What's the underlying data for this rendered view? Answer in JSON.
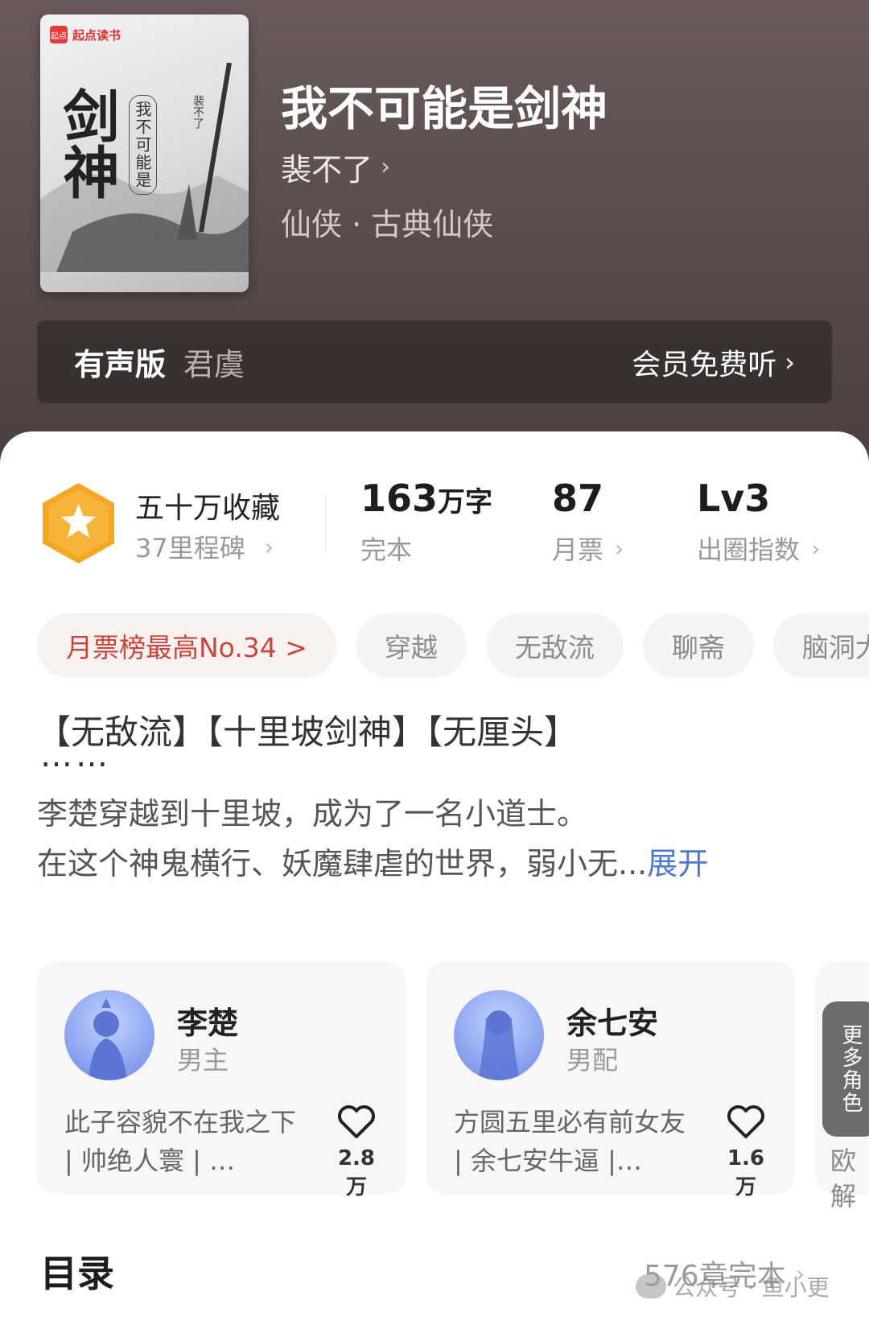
{
  "book": {
    "cover": {
      "publisher": "起点读书",
      "publisher_badge": "起点",
      "big_title": "剑神",
      "sub_title": "我不可能是",
      "author": "裴不了"
    },
    "title": "我不可能是剑神",
    "author": "裴不了",
    "genre": "仙侠 · 古典仙侠"
  },
  "audio": {
    "label": "有声版",
    "narrator": "君虞",
    "action": "会员免费听"
  },
  "stats": {
    "collect_main": "五十万收藏",
    "collect_sub": "37里程碑",
    "words_value": "163",
    "words_unit": "万字",
    "words_label": "完本",
    "tickets_value": "87",
    "tickets_label": "月票",
    "level_value": "Lv3",
    "level_label": "出圈指数"
  },
  "tags": {
    "rank": "月票榜最高No.34 >",
    "items": [
      "穿越",
      "无敌流",
      "聊斋",
      "脑洞大"
    ]
  },
  "synopsis": {
    "keywords": "【无敌流】【十里坡剑神】【无厘头】",
    "dots": "……",
    "line1": "李楚穿越到十里坡，成为了一名小道士。",
    "line2": "在这个神鬼横行、妖魔肆虐的世界，弱小无...",
    "expand": "展开"
  },
  "characters": [
    {
      "name": "李楚",
      "role": "男主",
      "desc": "此子容貌不在我之下 | 帅绝人寰 | …",
      "likes": "2.8万"
    },
    {
      "name": "余七安",
      "role": "男配",
      "desc": "方圆五里必有前女友 | 余七安牛逼 |…",
      "likes": "1.6万"
    }
  ],
  "more_chars": {
    "button": "更多角色",
    "text": "欧解"
  },
  "toc": {
    "title": "目录",
    "info": "576章完本"
  },
  "watermark": "公众号 · 鱼小更",
  "colors": {
    "header_bg": "#5a4d4c",
    "rank_text": "#c8463e",
    "expand_link": "#4a7bd0",
    "badge_orange": "#f5a623"
  }
}
